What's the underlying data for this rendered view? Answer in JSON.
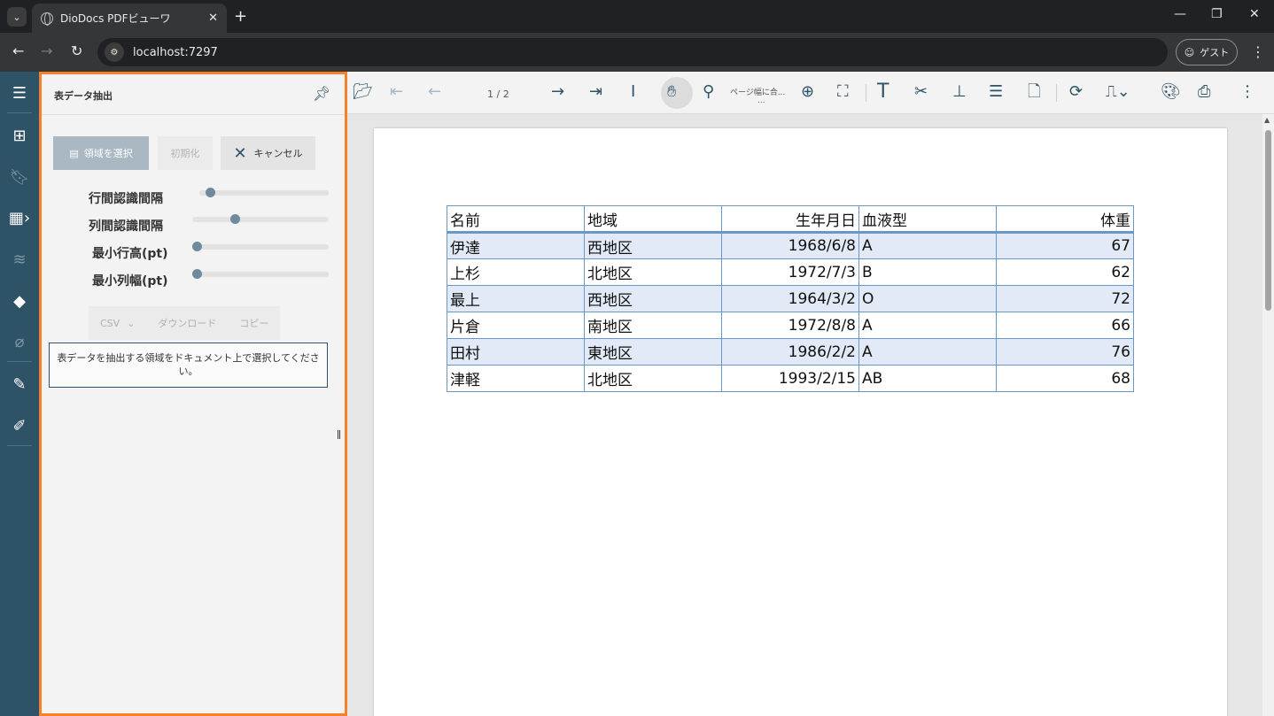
{
  "browser": {
    "tab_title": "DioDocs PDFビューワ",
    "url": "localhost:7297",
    "profile_label": "ゲスト",
    "tab_menu_icon": "chevron-down-icon",
    "close_tab": "✕",
    "new_tab": "+",
    "minimize": "—",
    "restore": "❐",
    "close": "✕"
  },
  "panel": {
    "title": "表データ抽出",
    "buttons": {
      "select_area": "領域を選択",
      "reset": "初期化",
      "cancel": "キャンセル"
    },
    "params": [
      {
        "label": "行間認識間隔",
        "value_fraction": 0.05
      },
      {
        "label": "列間認識間隔",
        "value_fraction": 0.3
      },
      {
        "label": "最小行高(pt)",
        "value_fraction": 0.0
      },
      {
        "label": "最小列幅(pt)",
        "value_fraction": 0.0
      }
    ],
    "export": {
      "format": "CSV",
      "download": "ダウンロード",
      "copy": "コピー"
    },
    "message": "表データを抽出する領域をドキュメント上で選択してください。"
  },
  "viewer": {
    "page_indicator": "1 / 2",
    "zoom_label": "ページ幅に合...",
    "zoom_ellipsis": "..."
  },
  "table": {
    "header": [
      "名前",
      "地域",
      "生年月日",
      "血液型",
      "体重"
    ],
    "rows": [
      [
        "伊達",
        "西地区",
        "1968/6/8",
        "A",
        "67"
      ],
      [
        "上杉",
        "北地区",
        "1972/7/3",
        "B",
        "62"
      ],
      [
        "最上",
        "西地区",
        "1964/3/2",
        "O",
        "72"
      ],
      [
        "片倉",
        "南地区",
        "1972/8/8",
        "A",
        "66"
      ],
      [
        "田村",
        "東地区",
        "1986/2/2",
        "A",
        "76"
      ],
      [
        "津軽",
        "北地区",
        "1993/2/15",
        "AB",
        "68"
      ]
    ]
  },
  "colors": {
    "accent": "#2e5266",
    "panel_border": "#f5822a",
    "table_border": "#6a96c8",
    "row_highlight": "#e1eaf6"
  }
}
